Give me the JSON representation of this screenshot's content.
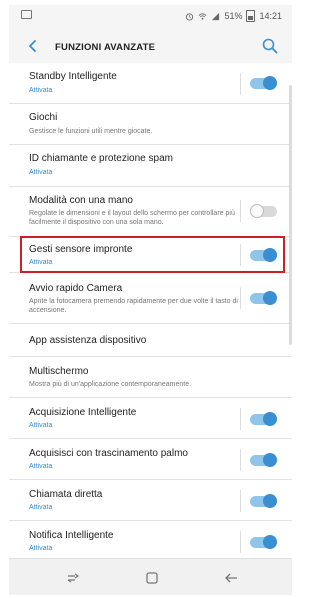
{
  "statusbar": {
    "battery": "51%",
    "time": "14:21"
  },
  "appbar": {
    "title": "FUNZIONI AVANZATE"
  },
  "items": [
    {
      "label": "Standby Intelligente",
      "sub": "Attivata",
      "sub_active": true,
      "toggle": "on"
    },
    {
      "label": "Giochi",
      "sub": "Gestisce le funzioni utili mentre giocate.",
      "sub_active": false,
      "toggle": null
    },
    {
      "label": "ID chiamante e protezione spam",
      "sub": "Attivata",
      "sub_active": true,
      "toggle": null
    },
    {
      "label": "Modalità con una mano",
      "sub": "Regolate le dimensioni e il layout dello schermo per controllare più facilmente il dispositivo con una sola mano.",
      "sub_active": false,
      "toggle": "off"
    },
    {
      "label": "Gesti sensore impronte",
      "sub": "Attivata",
      "sub_active": true,
      "toggle": "on"
    },
    {
      "label": "Avvio rapido Camera",
      "sub": "Aprite la fotocamera premendo rapidamente per due volte il tasto di accensione.",
      "sub_active": false,
      "toggle": "on"
    },
    {
      "label": "App assistenza dispositivo",
      "sub": "",
      "sub_active": false,
      "toggle": null
    },
    {
      "label": "Multischermo",
      "sub": "Mostra più di un'applicazione contemporaneamente.",
      "sub_active": false,
      "toggle": null
    },
    {
      "label": "Acquisizione Intelligente",
      "sub": "Attivata",
      "sub_active": true,
      "toggle": "on"
    },
    {
      "label": "Acquisisci con trascinamento palmo",
      "sub": "Attivata",
      "sub_active": true,
      "toggle": "on"
    },
    {
      "label": "Chiamata diretta",
      "sub": "Attivata",
      "sub_active": true,
      "toggle": "on"
    },
    {
      "label": "Notifica Intelligente",
      "sub": "Attivata",
      "sub_active": true,
      "toggle": "on"
    }
  ],
  "icons": {
    "back": "arrow-left-icon",
    "search": "search-icon",
    "recent": "recent-apps-icon",
    "home": "home-icon",
    "nav_back": "back-icon"
  },
  "colors": {
    "accent": "#3a8ed2",
    "toggle_track_on": "#8fc5ea",
    "highlight": "#cc1f28"
  }
}
